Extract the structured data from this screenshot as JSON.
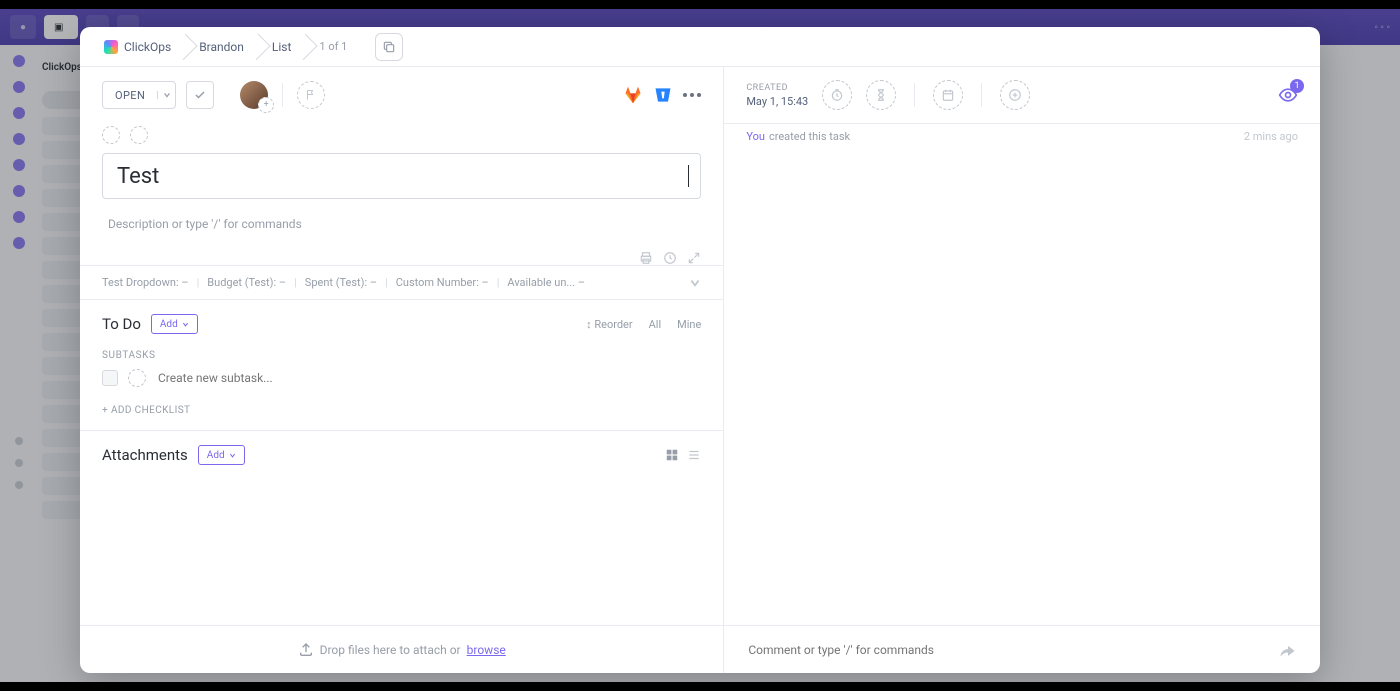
{
  "breadcrumbs": {
    "workspace": "ClickOps",
    "space": "Brandon",
    "list": "List",
    "position": "1 of 1"
  },
  "toolbar": {
    "open": "OPEN"
  },
  "task": {
    "title": "Test",
    "description_placeholder": "Description or type '/' for commands"
  },
  "custom_fields": [
    {
      "label": "Test Dropdown:",
      "value": "–"
    },
    {
      "label": "Budget (Test):",
      "value": "–"
    },
    {
      "label": "Spent (Test):",
      "value": "–"
    },
    {
      "label": "Custom Number:",
      "value": "–"
    },
    {
      "label": "Available un...",
      "value": "–"
    }
  ],
  "todo": {
    "heading": "To Do",
    "add": "Add",
    "links": {
      "reorder": "Reorder",
      "all": "All",
      "mine": "Mine"
    },
    "subtasks_label": "SUBTASKS",
    "new_subtask_placeholder": "Create new subtask...",
    "add_checklist": "+ ADD CHECKLIST"
  },
  "attachments": {
    "heading": "Attachments",
    "add": "Add"
  },
  "attach_footer": {
    "text": "Drop files here to attach or ",
    "link": "browse"
  },
  "meta": {
    "created_label": "CREATED",
    "created_value": "May 1, 15:43",
    "watchers": "1"
  },
  "activity": {
    "actor": "You",
    "text": "created this task",
    "time": "2 mins ago"
  },
  "comment": {
    "placeholder": "Comment or type '/' for commands"
  }
}
